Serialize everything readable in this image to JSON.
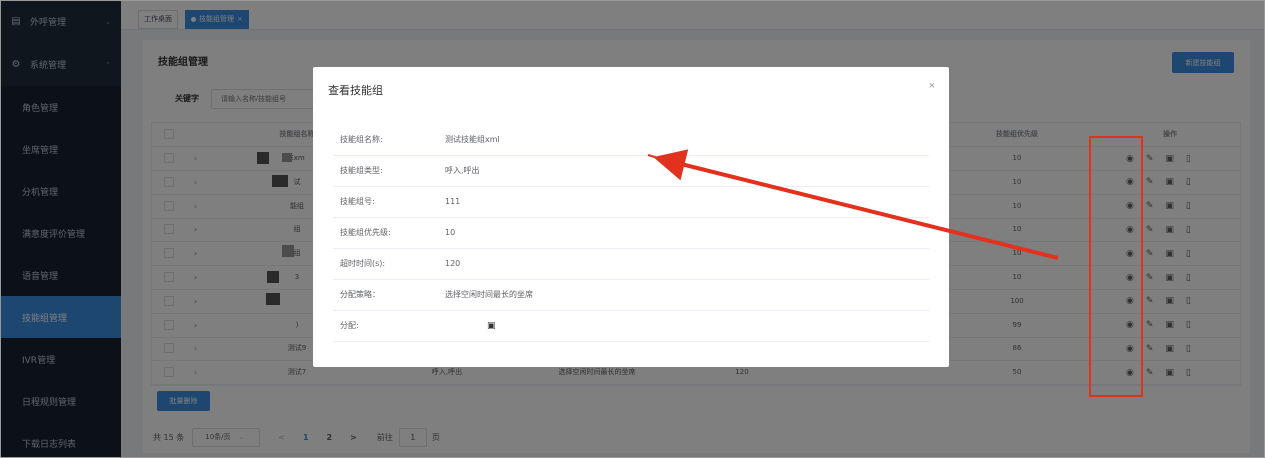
{
  "sidebar": {
    "groups": [
      {
        "label": "外呼管理",
        "icon": "document-icon"
      },
      {
        "label": "系统管理",
        "icon": "gear-icon"
      }
    ],
    "items": [
      {
        "label": "角色管理",
        "active": false
      },
      {
        "label": "坐席管理",
        "active": false
      },
      {
        "label": "分机管理",
        "active": false
      },
      {
        "label": "满意度评价管理",
        "active": false
      },
      {
        "label": "语音管理",
        "active": false
      },
      {
        "label": "技能组管理",
        "active": true
      },
      {
        "label": "IVR管理",
        "active": false
      },
      {
        "label": "日程规则管理",
        "active": false
      },
      {
        "label": "下载日志列表",
        "active": false
      }
    ]
  },
  "tags": [
    {
      "label": "工作桌面",
      "active": false
    },
    {
      "label": "技能组管理",
      "active": true,
      "close": "×"
    }
  ],
  "page": {
    "title": "技能组管理",
    "new_button": "新建技能组",
    "keyword_label": "关键字",
    "keyword_placeholder": "请输入名称/技能组号"
  },
  "table": {
    "headers": {
      "name": "技能组名称",
      "priority": "技能组优先级",
      "ops": "操作"
    },
    "rows": [
      {
        "name": "Exm",
        "priority": "10"
      },
      {
        "name": "试",
        "priority": "10"
      },
      {
        "name": "能组",
        "priority": "10"
      },
      {
        "name": "组",
        "priority": "10"
      },
      {
        "name": "组",
        "priority": "10"
      },
      {
        "name": "3",
        "priority": "10"
      },
      {
        "name": "",
        "priority": "100"
      },
      {
        "name": ")",
        "priority": "99"
      },
      {
        "name": "测试9",
        "priority": "86"
      },
      {
        "name": "测试7",
        "type": "呼入,呼出",
        "strategy": "选择空闲时间最长的坐席",
        "timeout": "120",
        "priority": "50"
      }
    ]
  },
  "batch_delete": "批量删除",
  "pagination": {
    "total": "共 15 条",
    "page_size": "10条/页",
    "prev": "<",
    "pages": [
      "1",
      "2"
    ],
    "next": ">",
    "goto_label": "前往",
    "goto_value": "1",
    "goto_suffix": "页"
  },
  "modal": {
    "title": "查看技能组",
    "close": "×",
    "fields": [
      {
        "label": "技能组名称:",
        "value": "测试技能组xml"
      },
      {
        "label": "技能组类型:",
        "value": "呼入,呼出"
      },
      {
        "label": "技能组号:",
        "value": "111"
      },
      {
        "label": "技能组优先级:",
        "value": "10"
      },
      {
        "label": "超时时间(s):",
        "value": "120"
      },
      {
        "label": "分配策略：",
        "value": "选择空闲时间最长的坐席"
      },
      {
        "label": "分配:",
        "value": ""
      }
    ]
  },
  "annotation": {
    "color": "#e0321c"
  },
  "colors": {
    "primary": "#3b8fe0",
    "sidebar": "#1f2d3d"
  }
}
